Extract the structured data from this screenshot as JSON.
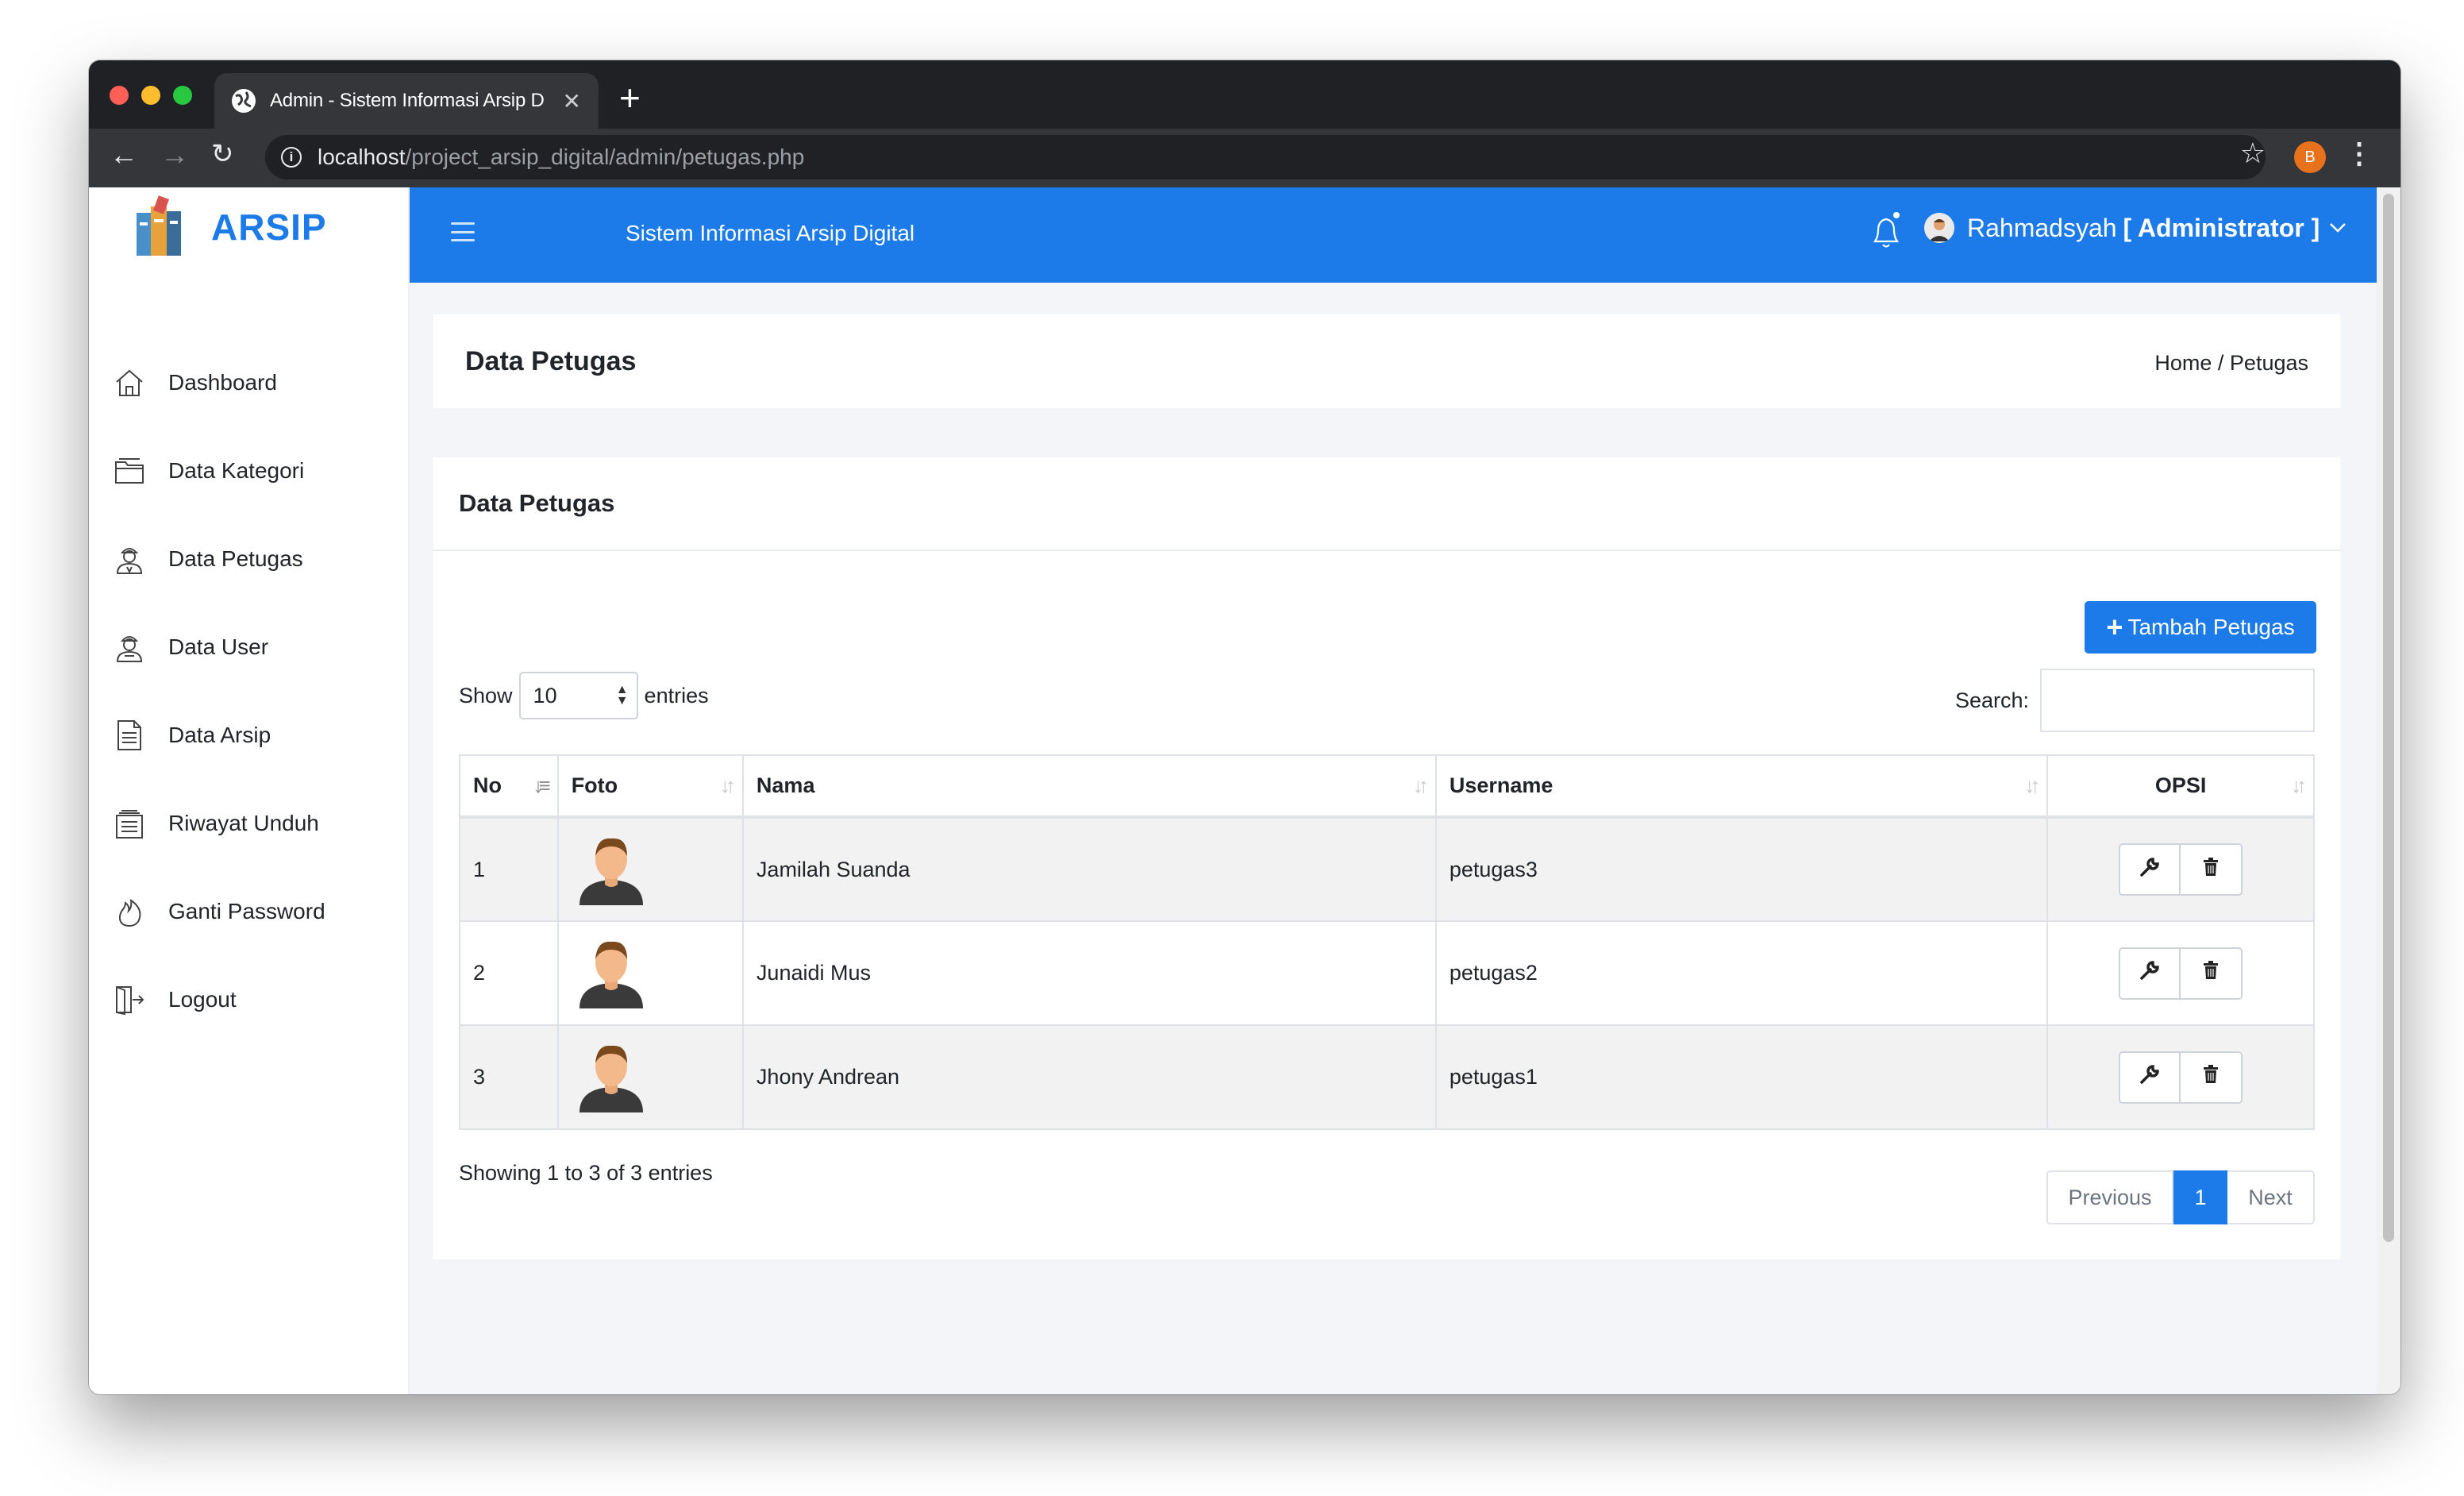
{
  "browser": {
    "tab_title": "Admin - Sistem Informasi Arsip D",
    "url_host": "localhost",
    "url_path": "/project_arsip_digital/admin/petugas.php",
    "profile_initial": "B"
  },
  "brand": {
    "name": "ARSIP",
    "accent_color": "#1c7be8"
  },
  "sidebar": {
    "items": [
      {
        "label": "Dashboard",
        "icon": "home-icon"
      },
      {
        "label": "Data Kategori",
        "icon": "folder-icon"
      },
      {
        "label": "Data Petugas",
        "icon": "officer-icon"
      },
      {
        "label": "Data User",
        "icon": "user-icon"
      },
      {
        "label": "Data Arsip",
        "icon": "document-icon"
      },
      {
        "label": "Riwayat Unduh",
        "icon": "history-icon"
      },
      {
        "label": "Ganti Password",
        "icon": "flame-icon"
      },
      {
        "label": "Logout",
        "icon": "exit-icon"
      }
    ]
  },
  "topbar": {
    "title": "Sistem Informasi Arsip Digital",
    "user_name": "Rahmadsyah",
    "user_role": "[ Administrator ]"
  },
  "page": {
    "heading": "Data Petugas",
    "breadcrumb": "Home / Petugas"
  },
  "card": {
    "title": "Data Petugas",
    "add_button": "Tambah Petugas",
    "show_label": "Show",
    "entries_value": "10",
    "entries_label": "entries",
    "search_label": "Search:",
    "search_value": ""
  },
  "table": {
    "headers": [
      "No",
      "Foto",
      "Nama",
      "Username",
      "OPSI"
    ],
    "rows": [
      {
        "no": "1",
        "nama": "Jamilah Suanda",
        "username": "petugas3"
      },
      {
        "no": "2",
        "nama": "Junaidi Mus",
        "username": "petugas2"
      },
      {
        "no": "3",
        "nama": "Jhony Andrean",
        "username": "petugas1"
      }
    ],
    "info": "Showing 1 to 3 of 3 entries",
    "pagination": {
      "previous": "Previous",
      "current": "1",
      "next": "Next"
    }
  }
}
